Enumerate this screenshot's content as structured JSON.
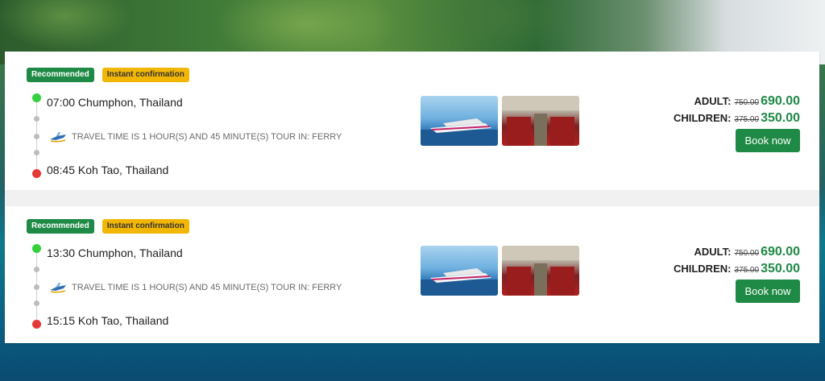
{
  "trips": [
    {
      "badges": [
        "Recommended",
        "Instant confirmation"
      ],
      "depart": "07:00 Chumphon, Thailand",
      "arrive": "08:45 Koh Tao, Thailand",
      "travel_text": "TRAVEL TIME IS 1 HOUR(S) AND 45 MINUTE(S) TOUR IN: FERRY",
      "prices": {
        "adult_label": "ADULT:",
        "adult_old": "750.00",
        "adult_new": "690.00",
        "children_label": "CHILDREN:",
        "children_old": "375.00",
        "children_new": "350.00"
      },
      "book_label": "Book now",
      "images": [
        "ferry-boat",
        "ferry-interior"
      ]
    },
    {
      "badges": [
        "Recommended",
        "Instant confirmation"
      ],
      "depart": "13:30 Chumphon, Thailand",
      "arrive": "15:15 Koh Tao, Thailand",
      "travel_text": "TRAVEL TIME IS 1 HOUR(S) AND 45 MINUTE(S) TOUR IN: FERRY",
      "prices": {
        "adult_label": "ADULT:",
        "adult_old": "750.00",
        "adult_new": "690.00",
        "children_label": "CHILDREN:",
        "children_old": "375.00",
        "children_new": "350.00"
      },
      "book_label": "Book now",
      "images": [
        "ferry-boat",
        "ferry-interior"
      ]
    }
  ],
  "colors": {
    "accent": "#1e8a45",
    "badge_yellow": "#f2b705",
    "start_dot": "#32d13d",
    "end_dot": "#e53935"
  }
}
